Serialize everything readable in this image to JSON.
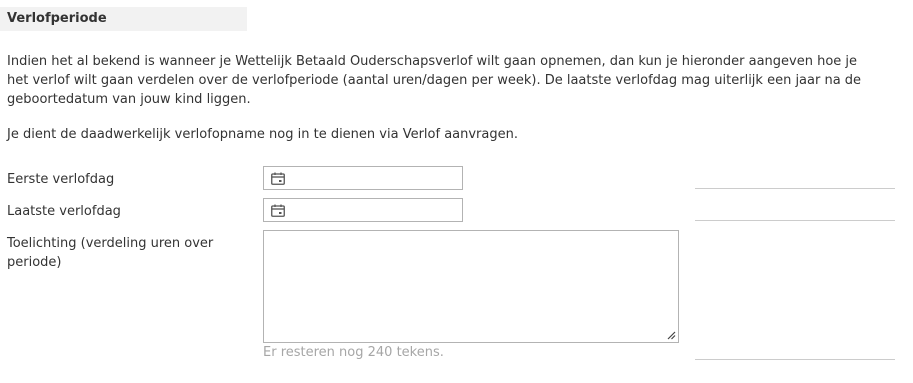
{
  "section": {
    "title": "Verlofperiode"
  },
  "intro": {
    "paragraph1": "Indien het al bekend is wanneer je Wettelijk Betaald Ouderschapsverlof wilt gaan opnemen, dan kun je hieronder aangeven hoe je het verlof wilt gaan verdelen over de verlofperiode (aantal uren/dagen per week). De laatste verlofdag mag uiterlijk een jaar na de geboortedatum van jouw kind liggen.",
    "paragraph2": "Je dient de daadwerkelijk verlofopname nog in te dienen via Verlof aanvragen."
  },
  "fields": {
    "first_day": {
      "label": "Eerste verlofdag",
      "value": "",
      "icon": "calendar-icon"
    },
    "last_day": {
      "label": "Laatste verlofdag",
      "value": "",
      "icon": "calendar-icon"
    },
    "explanation": {
      "label": "Toelichting (verdeling uren over periode)",
      "value": "",
      "counter_text": "Er resteren nog 240 tekens."
    }
  },
  "colors": {
    "header_bg": "#f2f2f2",
    "text": "#333333",
    "border": "#b3b3b3",
    "muted": "#a6a6a6"
  }
}
